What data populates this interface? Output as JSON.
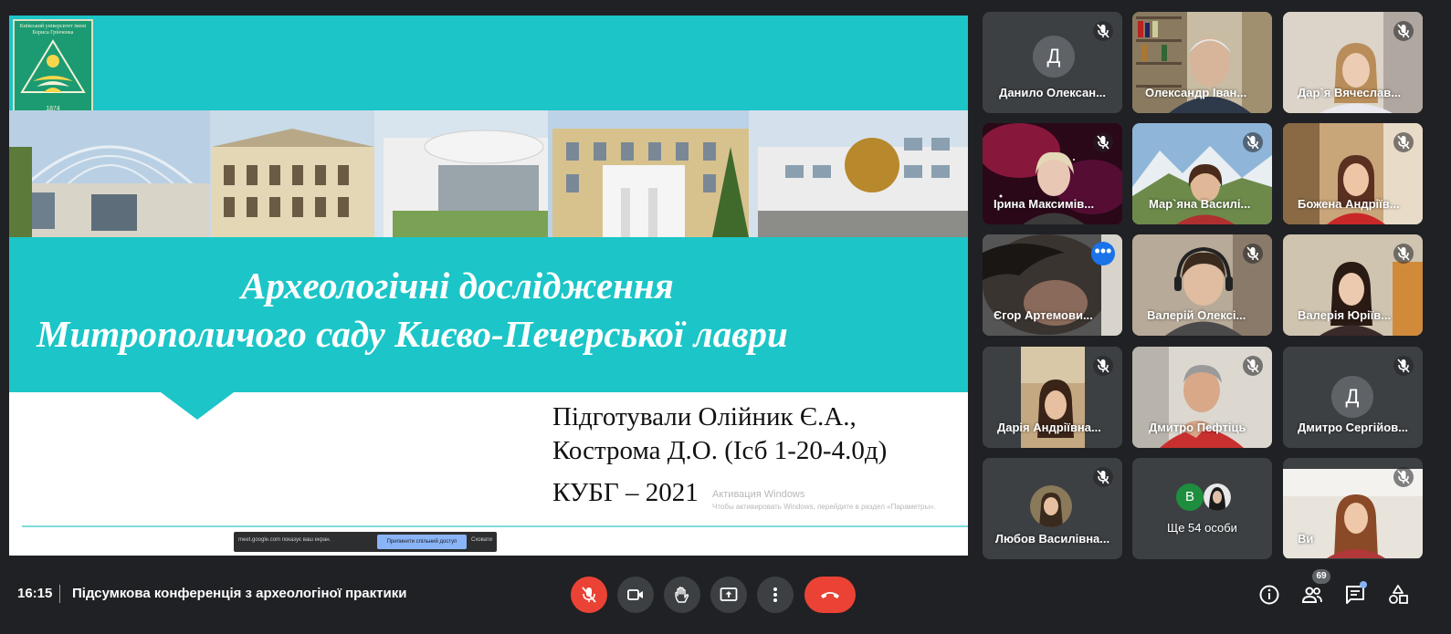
{
  "slide": {
    "logo_text": "Київський університет імені Бориса Грінченка",
    "logo_year": "1874",
    "title_line1": "Археологічні дослідження",
    "title_line2": "Митрополичого саду Києво-Печерської лаври",
    "authors_line1": "Підготували Олійник Є.А.,",
    "authors_line2": "Кострома Д.О. (Ісб 1-20-4.0д)",
    "year_line": "КУБГ – 2021",
    "watermark_line1": "Активация Windows",
    "watermark_line2": "Чтобы активировать Windows, перейдите в раздел «Параметры»."
  },
  "share_bar": {
    "message": "meet.google.com показує ваш екран.",
    "stop_label": "Припинити спільний доступ",
    "hide_label": "Сховати"
  },
  "participants": [
    {
      "name": "Данило Олексан...",
      "initial": "Д",
      "avatar_color": "#5f6368",
      "muted": true
    },
    {
      "name": "Олександр Іван...",
      "muted": false
    },
    {
      "name": "Дар`я Вячеслав...",
      "muted": true
    },
    {
      "name": "Ірина Максимів...",
      "muted": true
    },
    {
      "name": "Мар`яна Василі...",
      "muted": true
    },
    {
      "name": "Божена Андріїв...",
      "muted": true
    },
    {
      "name": "Єгор Артемови...",
      "muted": false,
      "active": true
    },
    {
      "name": "Валерій Олексі...",
      "muted": true
    },
    {
      "name": "Валерія Юріїв...",
      "muted": true
    },
    {
      "name": "Дарія Андріївна...",
      "muted": true
    },
    {
      "name": "Дмитро Пефтіць",
      "muted": true
    },
    {
      "name": "Дмитро Сергійов...",
      "initial": "Д",
      "avatar_color": "#5f6368",
      "muted": true
    },
    {
      "name": "Любов Василівна...",
      "muted": true
    },
    {
      "name": "Ще 54 особи",
      "mini_initial": "В",
      "mini_color": "#1e8e3e"
    },
    {
      "name": "Ви",
      "muted": true
    }
  ],
  "bottom_bar": {
    "time": "16:15",
    "meeting_title": "Підсумкова конференція з археологіної практики",
    "participant_count": "69"
  },
  "colors": {
    "slide_teal": "#1cc5c7",
    "background": "#202124",
    "tile": "#3c4043",
    "danger": "#ea4335",
    "accent": "#8ab4f8"
  },
  "icons": {
    "mic": "mic-off-icon",
    "camera": "camera-icon",
    "hand": "raise-hand-icon",
    "present": "present-screen-icon",
    "more": "more-options-icon",
    "hangup": "hang-up-icon",
    "info": "info-icon",
    "people": "people-icon",
    "chat": "chat-icon",
    "activities": "activities-icon"
  }
}
